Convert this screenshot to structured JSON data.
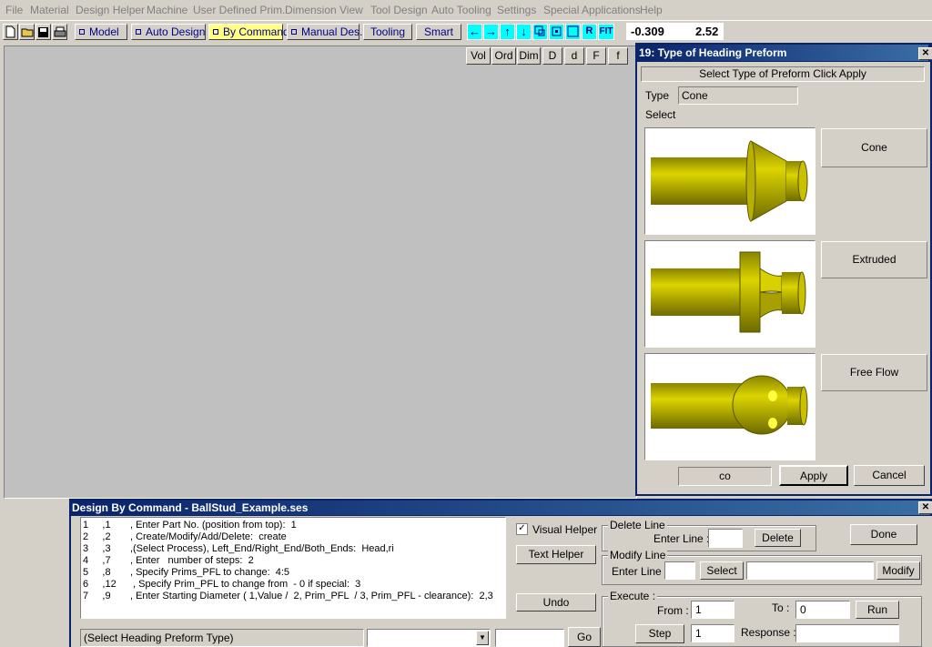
{
  "menu": [
    "File",
    "Material",
    "Design Helper",
    "Machine",
    "User Defined Prim.",
    "Dimension",
    "View",
    "Tool Design",
    "Auto Tooling",
    "Settings",
    "Special Applications",
    "Help"
  ],
  "toolbar": {
    "modes": [
      "Model",
      "Auto Design",
      "By Command",
      "Manual Des.",
      "Tooling",
      "Smart"
    ],
    "active_mode": "By Command",
    "icons": [
      "new-file-icon",
      "open-folder-icon",
      "save-icon",
      "print-icon"
    ],
    "nav": [
      "←",
      "→",
      "↑",
      "↓"
    ],
    "extra": [
      "R",
      "FIT"
    ],
    "coord_x": "-0.309",
    "coord_y": "2.52"
  },
  "view_buttons": [
    "Vol",
    "Ord",
    "Dim",
    "D",
    "d",
    "F",
    "f"
  ],
  "preform_dialog": {
    "title": "19: Type of Heading Preform",
    "instruction": "Select Type of Preform  Click Apply",
    "type_label": "Type",
    "type_value": "Cone",
    "select_label": "Select",
    "options": [
      "Cone",
      "Extruded",
      "Free Flow"
    ],
    "input_value": "co",
    "apply": "Apply",
    "cancel": "Cancel",
    "shape_color": "#c8c000"
  },
  "command_dialog": {
    "title": "Design By Command - BallStud_Example.ses",
    "lines": [
      "1     ,1       , Enter Part No. (position from top):  1",
      "2     ,2       , Create/Modify/Add/Delete:  create",
      "3     ,3       ,(Select Process), Left_End/Right_End/Both_Ends:  Head,ri",
      "4     ,7       , Enter   number of steps:  2",
      "5     ,8       , Specify Prims_PFL to change:  4:5",
      "6     ,12      , Specify Prim_PFL to change from  - 0 if special:  3",
      "7     ,9       , Enter Starting Diameter ( 1,Value /  2, Prim_PFL  / 3, Prim_PFL - clearance):  2,3"
    ],
    "visual_helper": "Visual Helper",
    "text_helper": "Text Helper",
    "undo": "Undo",
    "status": "(Select  Heading Preform Type)",
    "go": "Go",
    "delete_line": {
      "legend": "Delete Line",
      "enter_line": "Enter Line :",
      "button": "Delete"
    },
    "done": "Done",
    "modify_line": {
      "legend": "Modify Line",
      "enter_line": "Enter Line :",
      "select": "Select",
      "modify": "Modify"
    },
    "execute": {
      "legend": "Execute :",
      "from_label": "From :",
      "from_value": "1",
      "to_label": "To :",
      "to_value": "0",
      "run": "Run",
      "step": "Step",
      "step_value": "1",
      "response_label": "Response :"
    }
  }
}
